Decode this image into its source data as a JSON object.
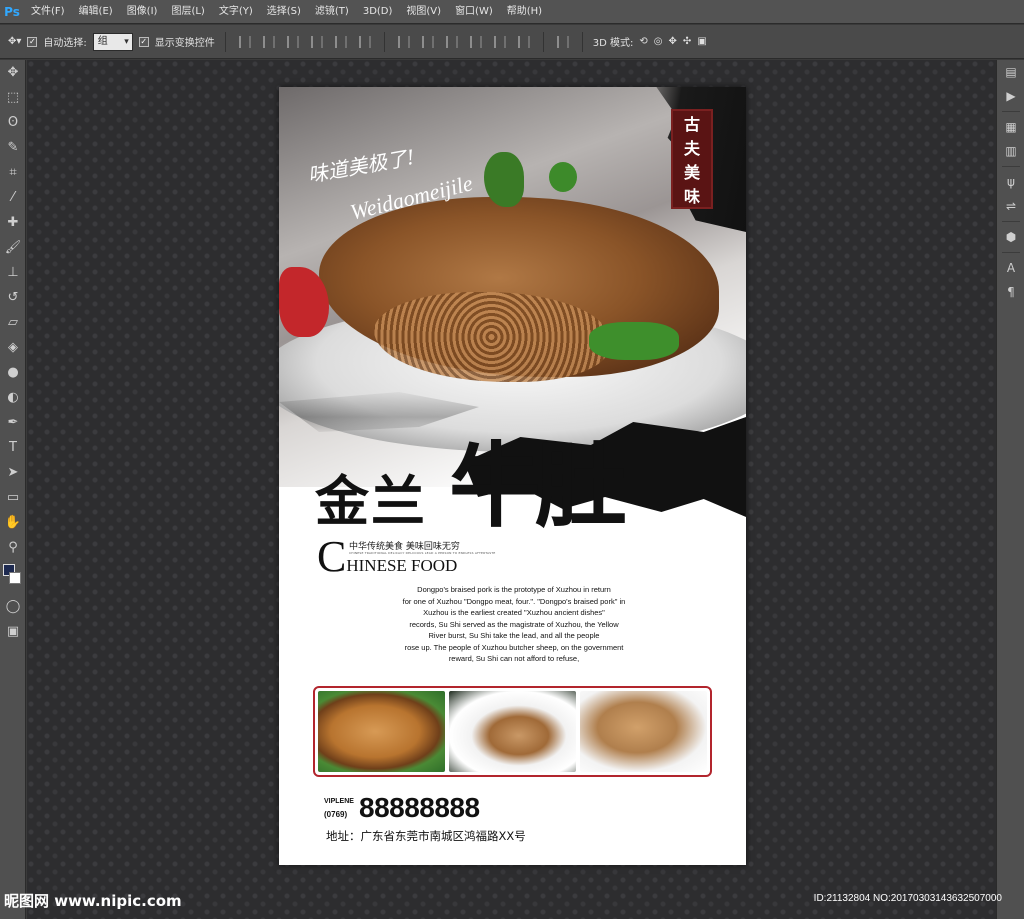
{
  "app": {
    "logo": "Ps"
  },
  "menu": [
    "文件(F)",
    "编辑(E)",
    "图像(I)",
    "图层(L)",
    "文字(Y)",
    "选择(S)",
    "滤镜(T)",
    "3D(D)",
    "视图(V)",
    "窗口(W)",
    "帮助(H)"
  ],
  "options": {
    "auto_select_label": "自动选择:",
    "auto_select_value": "组",
    "show_transform_label": "显示变换控件",
    "mode_3d_label": "3D 模式:"
  },
  "left_tools": [
    "move-icon",
    "marquee-icon",
    "lasso-icon",
    "quick-select-icon",
    "crop-icon",
    "eyedropper-icon",
    "healing-icon",
    "brush-icon",
    "stamp-icon",
    "history-brush-icon",
    "eraser-icon",
    "paint-bucket-icon",
    "blur-icon",
    "dodge-icon",
    "pen-icon",
    "type-icon",
    "path-select-icon",
    "rectangle-icon",
    "hand-icon",
    "zoom-icon"
  ],
  "poster": {
    "stamp_chars": [
      "古",
      "夫",
      "美",
      "味"
    ],
    "script_cn": "味道美极了!",
    "script_en": "Weidaomeijile",
    "title_left": "金兰",
    "title_right": "牛肚",
    "subtitle_cn": "中华传统美食  美味回味无穷",
    "subtitle_tiny": "CHINESE TRADITIONAL DELICACY DELICIOUS LEAD A PERSON TO ENDLESS AFTERTASTE",
    "cf_c": "C",
    "cf_rest": "HINESE FOOD",
    "body_lines": [
      "Dongpo's braised pork is the prototype of Xuzhou in return",
      "for one of Xuzhou \"Dongpo meat, four.\". \"Dongpo's braised pork\" in",
      "Xuzhou is the earliest created \"Xuzhou ancient dishes\"",
      "records, Su Shi served as the magistrate of Xuzhou, the Yellow",
      "River burst, Su Shi take the lead, and all the people",
      "rose up. The people of Xuzhou butcher sheep, on the government",
      "reward, Su Shi can not afford to refuse,"
    ],
    "vip": "VIPLENE",
    "area_code": "(0769)",
    "phone": "88888888",
    "address": "地址：广东省东莞市南城区鸿福路XX号"
  },
  "watermark": {
    "left": "昵图网 www.nipic.com",
    "right": "ID:21132804 NO:20170303143632507000"
  },
  "colors": {
    "stamp": "#5a1414",
    "strip_border": "#b2252d",
    "ps_blue": "#31a8ff"
  }
}
